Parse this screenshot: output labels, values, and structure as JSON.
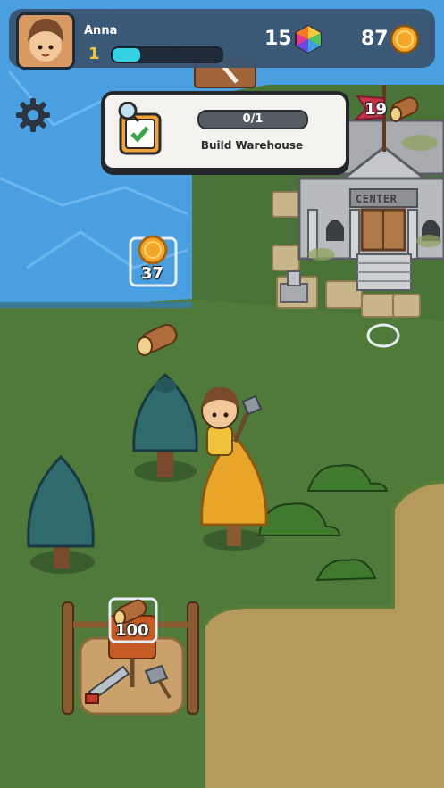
{
  "player": {
    "name": "Anna",
    "level": "1",
    "xp_progress": 0.25
  },
  "resources": {
    "gems": "15",
    "coins": "87"
  },
  "quest": {
    "progress": "0/1",
    "title": "Build Warehouse"
  },
  "map": {
    "coin_drop_value": "37",
    "building_wood_requirement": "19",
    "building_name": "CENTER",
    "sawmill_wood_cost": "100"
  },
  "colors": {
    "water": "#4a9fe0",
    "grass": "#4f7a3a",
    "dirt": "#b69a5d",
    "hud": "#3b5573",
    "xp": "#35d2e6"
  }
}
